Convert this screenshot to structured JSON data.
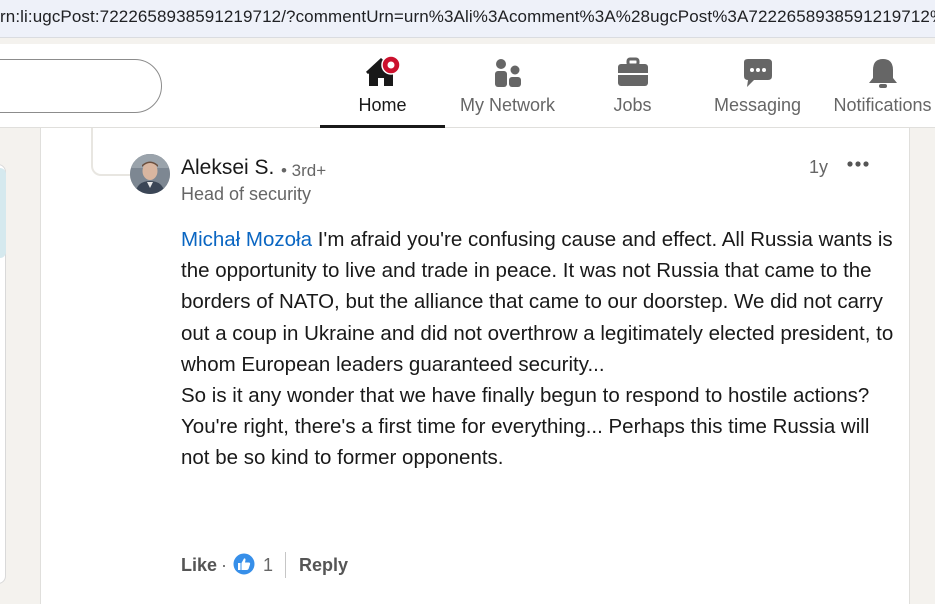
{
  "browser": {
    "url": "rn:li:ugcPost:7222658938591219712/?commentUrn=urn%3Ali%3Acomment%3A%28ugcPost%3A7222658938591219712%2"
  },
  "nav": {
    "items": [
      {
        "label": "Home",
        "icon": "home-icon",
        "active": true
      },
      {
        "label": "My Network",
        "icon": "people-icon"
      },
      {
        "label": "Jobs",
        "icon": "briefcase-icon"
      },
      {
        "label": "Messaging",
        "icon": "chat-icon"
      },
      {
        "label": "Notifications",
        "icon": "bell-icon"
      }
    ]
  },
  "comment": {
    "author": "Aleksei S.",
    "degree": "• 3rd+",
    "headline": "Head of security",
    "time": "1y",
    "mention": "Michał Mozoła",
    "paragraphs": [
      " I'm afraid you're confusing cause and effect. All Russia wants is the opportunity to live and trade in peace. It was not Russia that came to the borders of NATO, but the alliance that came to our doorstep. We did not carry out a coup in Ukraine and did not overthrow a legitimately elected president, to whom European leaders guaranteed security...",
      "So is it any wonder that we have finally begun to respond to hostile actions?",
      "You're right, there's a first time for everything... Perhaps this time Russia will not be so kind to former opponents."
    ],
    "like_label": "Like",
    "separator_dot": "·",
    "reaction_count": "1",
    "reply_label": "Reply"
  },
  "colors": {
    "accent": "#0a66c2",
    "notification_badge": "#cb112d"
  }
}
